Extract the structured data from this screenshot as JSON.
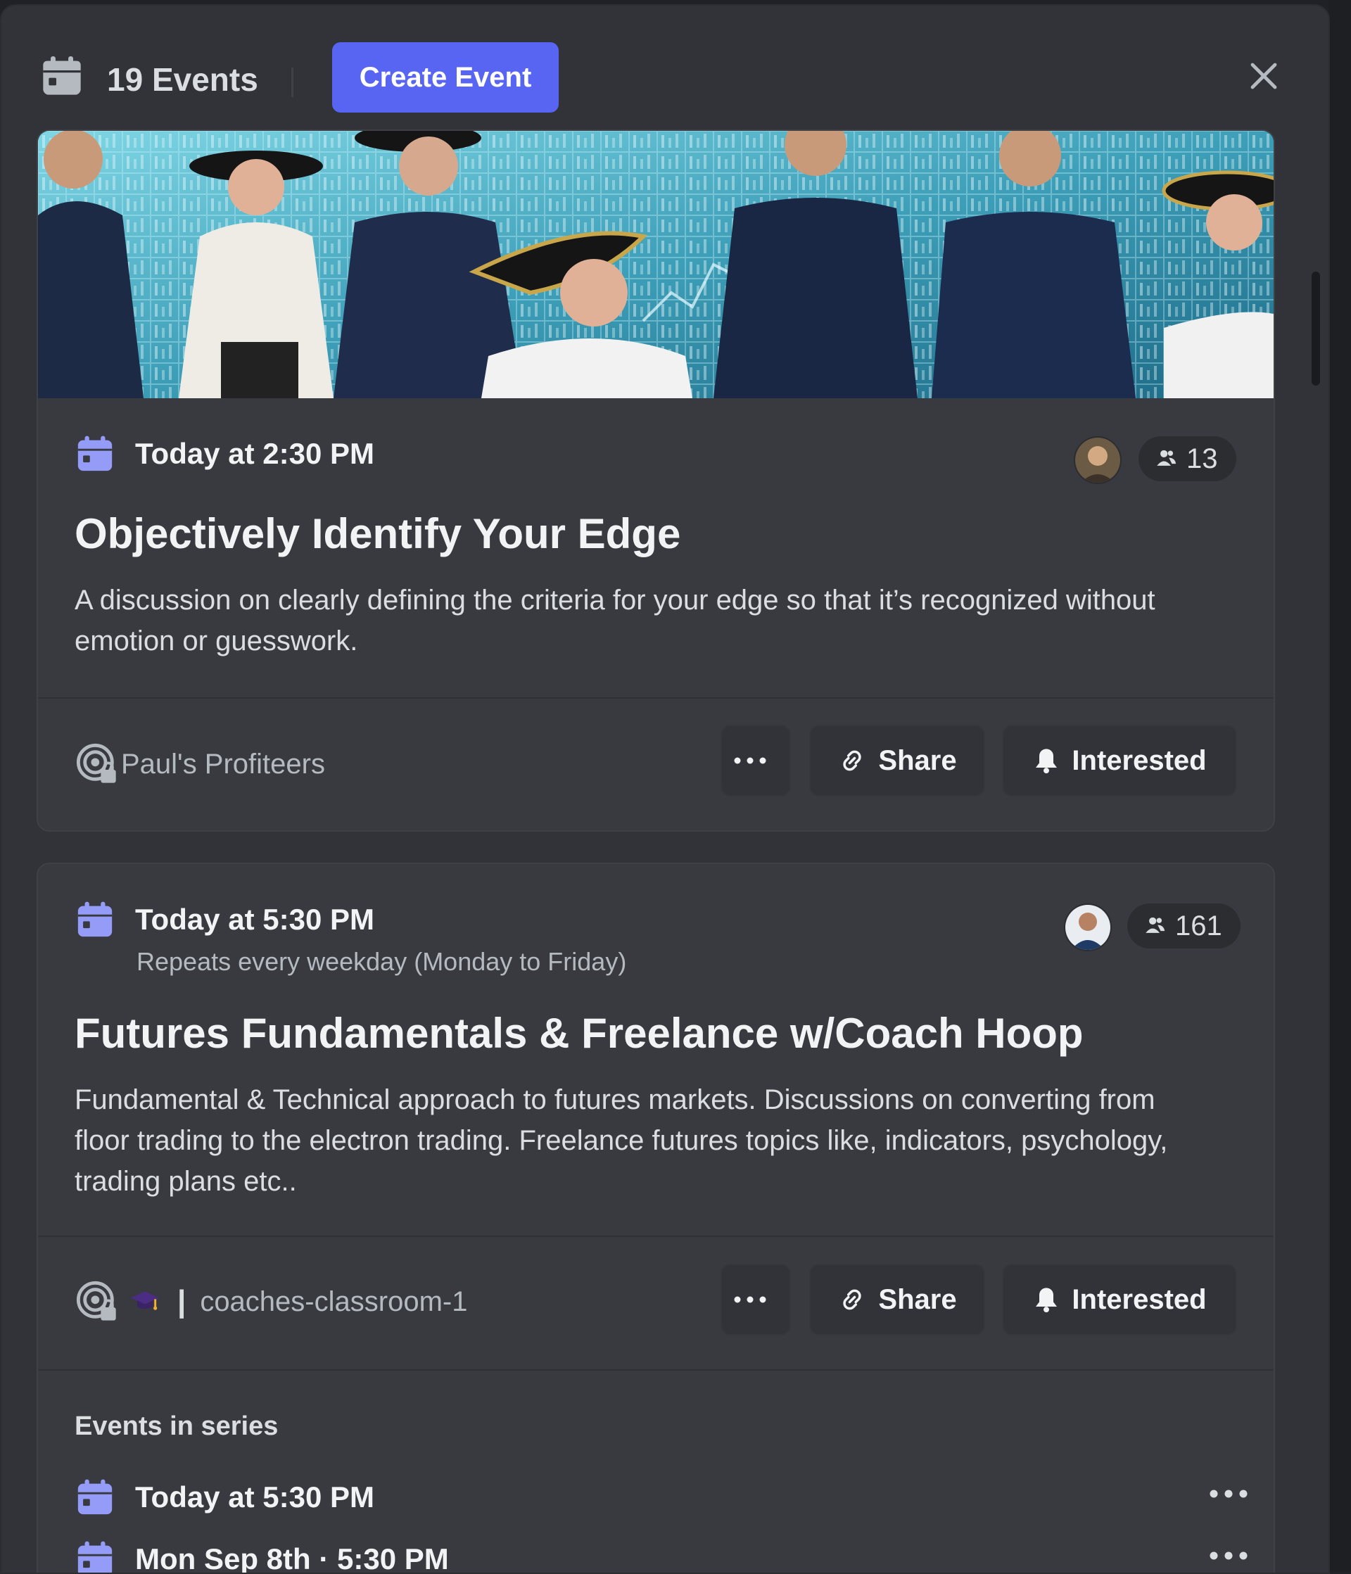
{
  "header": {
    "title": "19 Events",
    "create_label": "Create Event"
  },
  "events": [
    {
      "time": "Today at 2:30 PM",
      "interested_count": "13",
      "title": "Objectively Identify Your Edge",
      "description": "A discussion on clearly defining  the criteria for your edge so that it’s recognized without emotion or guesswork.",
      "location": "Paul's Profiteers",
      "share_label": "Share",
      "interested_label": "Interested"
    },
    {
      "time": "Today at 5:30 PM",
      "repeat": "Repeats every weekday (Monday to Friday)",
      "interested_count": "161",
      "title": "Futures Fundamentals & Freelance w/Coach Hoop",
      "description": "Fundamental & Technical approach to futures markets. Discussions  on converting from floor trading to the electron trading. Freelance futures topics like, indicators, psychology, trading plans etc..",
      "location_pipe": "|",
      "location": "coaches-classroom-1",
      "share_label": "Share",
      "interested_label": "Interested",
      "series_heading": "Events in series",
      "series": [
        {
          "time": "Today at 5:30 PM"
        },
        {
          "time": "Mon Sep 8th · 5:30 PM"
        }
      ]
    }
  ],
  "colors": {
    "accent": "#5865f2",
    "calendar_icon": "#949cf7",
    "modal_bg": "#313338",
    "card_bg": "#383a40"
  }
}
